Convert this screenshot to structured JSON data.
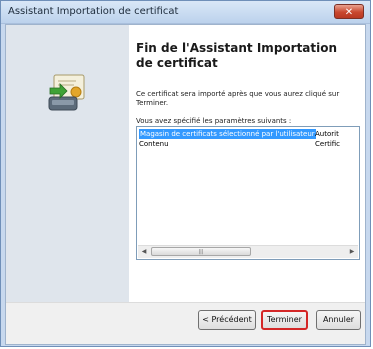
{
  "window": {
    "title": "Assistant Importation de certificat"
  },
  "wizard": {
    "heading": "Fin de l'Assistant Importation de certificat",
    "description": "Ce certificat sera importé après que vous aurez cliqué sur Terminer.",
    "params_label": "Vous avez spécifié les paramètres suivants :",
    "params": [
      {
        "name": "Magasin de certificats sélectionné par l'utilisateur",
        "value": "Autorit"
      },
      {
        "name": "Contenu",
        "value": "Certific"
      }
    ]
  },
  "buttons": {
    "prev": "< Précédent",
    "finish": "Terminer",
    "cancel": "Annuler"
  },
  "colors": {
    "finish_highlight": "#d42727",
    "selection": "#3399ff"
  }
}
